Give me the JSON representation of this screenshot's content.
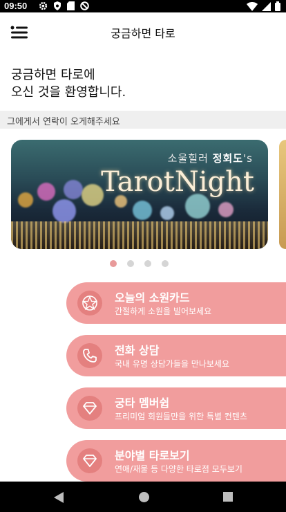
{
  "status_bar": {
    "time": "09:50",
    "left_icons": [
      "gear-icon",
      "shield-icon",
      "sd-card-icon",
      "no-sign-icon"
    ],
    "right_icons": [
      "wifi-icon",
      "signal-icon",
      "battery-icon"
    ]
  },
  "app_bar": {
    "title": "궁금하면 타로",
    "menu_icon": "menu-icon"
  },
  "welcome": {
    "line1": "궁금하면 타로에",
    "line2": "오신 것을 환영합니다."
  },
  "contact_strip": {
    "text": "그에게서 연락이 오게해주세요"
  },
  "banner": {
    "subtitle_prefix": "소울힐러 ",
    "subtitle_name": "정회도",
    "subtitle_suffix": "'s",
    "title": "TarotNight"
  },
  "pager": {
    "count": 4,
    "active_index": 0
  },
  "cards": [
    {
      "title": "오늘의 소원카드",
      "subtitle": "간절하게 소원을 빌어보세요",
      "icon": "pentagram-icon"
    },
    {
      "title": "전화 상담",
      "subtitle": "국내 유명 상담가들을 만나보세요",
      "icon": "phone-icon"
    },
    {
      "title": "궁타 멤버쉽",
      "subtitle": "프리미엄 회원들만을 위한 특별 컨텐츠",
      "icon": "diamond-icon"
    },
    {
      "title": "분야별 타로보기",
      "subtitle": "연애/재물 등 다양한 타로점 모두보기",
      "icon": "diamond-icon"
    }
  ],
  "colors": {
    "card_bg": "#f19d9d",
    "card_icon_bg": "#e4807f",
    "pager_active": "#e89a9a",
    "pager_inactive": "#d5d5d5"
  },
  "nav_bar": {
    "icons": [
      "back-icon",
      "home-icon",
      "recents-icon"
    ]
  }
}
